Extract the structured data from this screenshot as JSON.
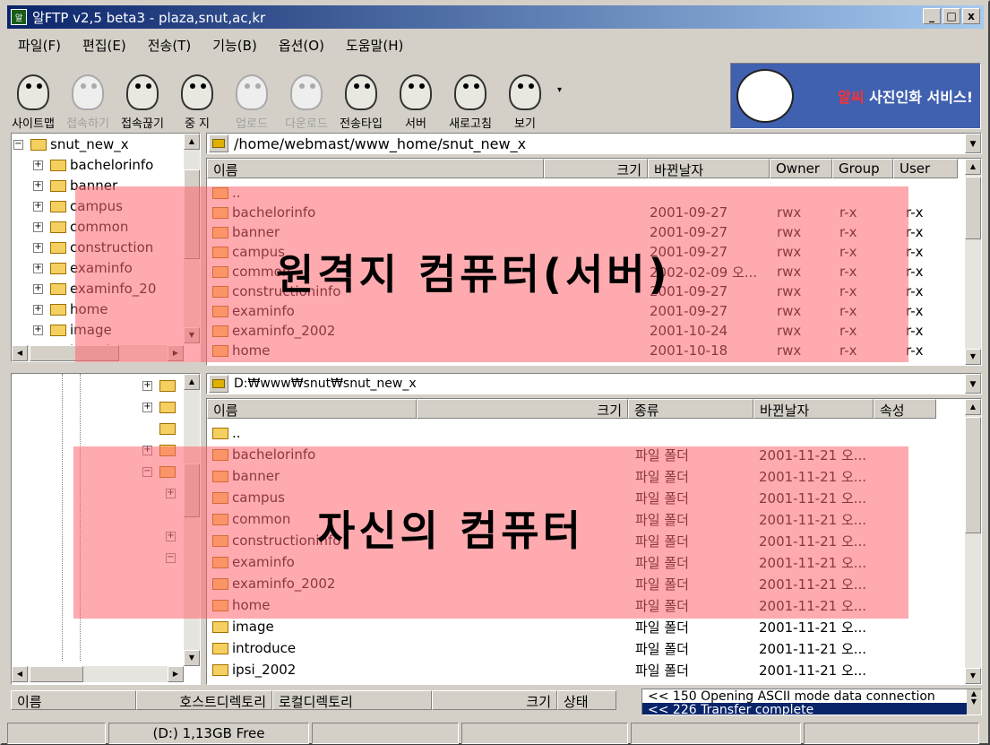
{
  "window": {
    "title": "알FTP v2,5 beta3 - plaza,snut,ac,kr",
    "buttons": [
      "_",
      "□",
      "x"
    ]
  },
  "menu": [
    "파일(F)",
    "편집(E)",
    "전송(T)",
    "기능(B)",
    "옵션(O)",
    "도움말(H)"
  ],
  "toolbar": [
    {
      "label": "사이트맵",
      "enabled": true
    },
    {
      "label": "접속하기",
      "enabled": false
    },
    {
      "label": "접속끊기",
      "enabled": true
    },
    {
      "label": "중 지",
      "enabled": true
    },
    {
      "label": "업로드",
      "enabled": false
    },
    {
      "label": "다운로드",
      "enabled": false
    },
    {
      "label": "전송타입",
      "enabled": true
    },
    {
      "label": "서버",
      "enabled": true
    },
    {
      "label": "새로고침",
      "enabled": true
    },
    {
      "label": "보기",
      "enabled": true
    }
  ],
  "banner": {
    "highlight": "알씨",
    "text": "사진인화 서비스!"
  },
  "remote": {
    "tree_root": "snut_new_x",
    "tree_items": [
      "bachelorinfo",
      "banner",
      "campus",
      "common",
      "construction",
      "examinfo",
      "examinfo_20",
      "home",
      "image",
      "introduce"
    ],
    "path": "/home/webmast/www_home/snut_new_x",
    "columns": [
      "이름",
      "크기",
      "바뀐날자",
      "Owner",
      "Group",
      "User"
    ],
    "rows": [
      {
        "name": "..",
        "date": "",
        "owner": "",
        "group": "",
        "user": ""
      },
      {
        "name": "bachelorinfo",
        "date": "2001-09-27",
        "owner": "rwx",
        "group": "r-x",
        "user": "r-x"
      },
      {
        "name": "banner",
        "date": "2001-09-27",
        "owner": "rwx",
        "group": "r-x",
        "user": "r-x"
      },
      {
        "name": "campus",
        "date": "2001-09-27",
        "owner": "rwx",
        "group": "r-x",
        "user": "r-x"
      },
      {
        "name": "common",
        "date": "2002-02-09 오...",
        "owner": "rwx",
        "group": "r-x",
        "user": "r-x"
      },
      {
        "name": "constructioninfo",
        "date": "2001-09-27",
        "owner": "rwx",
        "group": "r-x",
        "user": "r-x"
      },
      {
        "name": "examinfo",
        "date": "2001-09-27",
        "owner": "rwx",
        "group": "r-x",
        "user": "r-x"
      },
      {
        "name": "examinfo_2002",
        "date": "2001-10-24",
        "owner": "rwx",
        "group": "r-x",
        "user": "r-x"
      },
      {
        "name": "home",
        "date": "2001-10-18",
        "owner": "rwx",
        "group": "r-x",
        "user": "r-x"
      }
    ],
    "overlay_label": "원격지 컴퓨터(서버)"
  },
  "local": {
    "path": "D:₩www₩snut₩snut_new_x",
    "columns": [
      "이름",
      "크기",
      "종류",
      "바뀐날자",
      "속성"
    ],
    "rows": [
      {
        "name": "..",
        "type": "",
        "date": ""
      },
      {
        "name": "bachelorinfo",
        "type": "파일 폴더",
        "date": "2001-11-21 오..."
      },
      {
        "name": "banner",
        "type": "파일 폴더",
        "date": "2001-11-21 오..."
      },
      {
        "name": "campus",
        "type": "파일 폴더",
        "date": "2001-11-21 오..."
      },
      {
        "name": "common",
        "type": "파일 폴더",
        "date": "2001-11-21 오..."
      },
      {
        "name": "constructioninfo",
        "type": "파일 폴더",
        "date": "2001-11-21 오..."
      },
      {
        "name": "examinfo",
        "type": "파일 폴더",
        "date": "2001-11-21 오..."
      },
      {
        "name": "examinfo_2002",
        "type": "파일 폴더",
        "date": "2001-11-21 오..."
      },
      {
        "name": "home",
        "type": "파일 폴더",
        "date": "2001-11-21 오..."
      },
      {
        "name": "image",
        "type": "파일 폴더",
        "date": "2001-11-21 오..."
      },
      {
        "name": "introduce",
        "type": "파일 폴더",
        "date": "2001-11-21 오..."
      },
      {
        "name": "ipsi_2002",
        "type": "파일 폴더",
        "date": "2001-11-21 오..."
      }
    ],
    "overlay_label": "자신의 컴퓨터"
  },
  "queue_columns": [
    "이름",
    "호스트디렉토리",
    "로컬디렉토리",
    "크기",
    "상태"
  ],
  "log": [
    "<< 150 Opening ASCII mode data connection",
    "<< 226 Transfer complete"
  ],
  "status": {
    "drive": "(D:) 1,13GB Free"
  },
  "colors": {
    "overlay": "#ff646e",
    "titlebar": "#0a246a",
    "face": "#d4d0c8"
  }
}
